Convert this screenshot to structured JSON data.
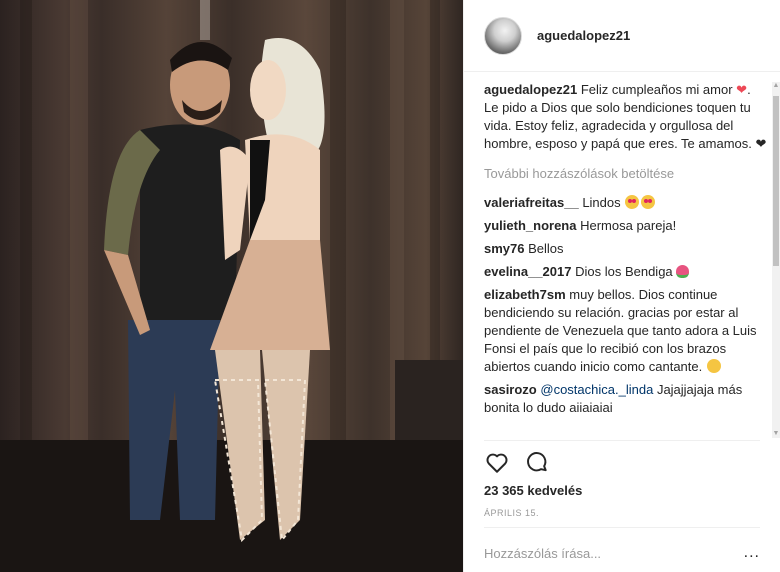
{
  "photo": {
    "alt": "",
    "icon": "post-photo"
  },
  "header": {
    "username": "aguedalopez21",
    "avatar_icon": "avatar"
  },
  "caption": {
    "username": "aguedalopez21",
    "text_before_heart": "Feliz cumpleaños mi amor",
    "heart": "❤",
    "text_after_heart": ". Le pido a Dios que solo bendiciones toquen tu vida. Estoy feliz, agradecida y orgullosa del hombre, esposo y papá que eres. Te amamos. ❤"
  },
  "load_more": "További hozzászólások betöltése",
  "comments": [
    {
      "user": "valeriafreitas__",
      "text": "Lindos",
      "emoji": "heart-eyes-x2"
    },
    {
      "user": "yulieth_norena",
      "text": "Hermosa pareja!"
    },
    {
      "user": "smy76",
      "text": "Bellos"
    },
    {
      "user": "evelina__2017",
      "text": "Dios los Bendiga",
      "emoji": "tulip"
    },
    {
      "user": "elizabeth7sm",
      "text": "muy bellos. Dios continue bendiciendo su relación. gracias por estar al pendiente de Venezuela que tanto adora a Luis Fonsi el país que lo recibió con los brazos abiertos cuando inicio como cantante.",
      "emoji": "smile"
    },
    {
      "user": "sasirozo",
      "mention": "@costachica._linda",
      "text": "Jajajjajaja más bonita lo dudo aiiaiaiai"
    }
  ],
  "actions": {
    "like_icon": "heart-outline-icon",
    "comment_icon": "comment-bubble-icon"
  },
  "likes": "23 365 kedvelés",
  "date": "ÁPRILIS 15.",
  "add_comment": {
    "placeholder": "Hozzászólás írása...",
    "more_label": "..."
  },
  "colors": {
    "text": "#262626",
    "muted": "#999999",
    "mention": "#003569",
    "heart": "#ed4956",
    "border": "#efefef"
  }
}
